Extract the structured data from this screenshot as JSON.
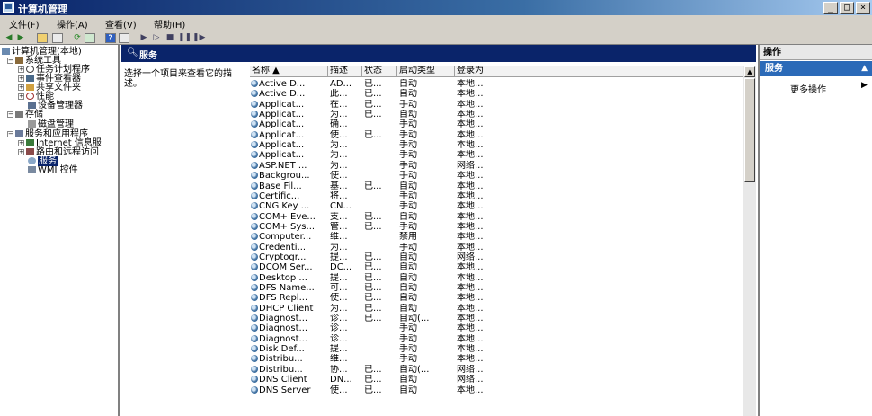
{
  "window": {
    "title": "计算机管理",
    "buttons": [
      "_",
      "□",
      "×"
    ]
  },
  "menu": [
    "文件(F)",
    "操作(A)",
    "查看(V)",
    "帮助(H)"
  ],
  "toolbar": {
    "icons": [
      "back-icon",
      "forward-icon",
      "up-folder-icon",
      "show-hide-tree-icon",
      "refresh-icon",
      "export-icon",
      "help-icon",
      "properties-icon",
      "play-icon",
      "play-alt-icon",
      "stop-icon",
      "pause-icon",
      "restart-icon"
    ]
  },
  "tree": [
    {
      "label": "计算机管理(本地)",
      "level": 0,
      "expander": "",
      "icon": "computer-icon"
    },
    {
      "label": "系统工具",
      "level": 1,
      "expander": "−",
      "icon": "tools-icon"
    },
    {
      "label": "任务计划程序",
      "level": 2,
      "expander": "+",
      "icon": "clock-icon"
    },
    {
      "label": "事件查看器",
      "level": 2,
      "expander": "+",
      "icon": "event-viewer-icon"
    },
    {
      "label": "共享文件夹",
      "level": 2,
      "expander": "+",
      "icon": "shared-folder-icon"
    },
    {
      "label": "性能",
      "level": 2,
      "expander": "+",
      "icon": "performance-icon"
    },
    {
      "label": "设备管理器",
      "level": 2,
      "expander": "",
      "icon": "device-manager-icon"
    },
    {
      "label": "存储",
      "level": 1,
      "expander": "−",
      "icon": "storage-icon"
    },
    {
      "label": "磁盘管理",
      "level": 2,
      "expander": "",
      "icon": "disk-icon"
    },
    {
      "label": "服务和应用程序",
      "level": 1,
      "expander": "−",
      "icon": "services-apps-icon"
    },
    {
      "label": "Internet 信息服",
      "level": 2,
      "expander": "+",
      "icon": "iis-icon"
    },
    {
      "label": "路由和远程访问",
      "level": 2,
      "expander": "+",
      "icon": "routing-icon"
    },
    {
      "label": "服务",
      "level": 2,
      "expander": "",
      "icon": "services-icon",
      "selected": true
    },
    {
      "label": "WMI 控件",
      "level": 2,
      "expander": "",
      "icon": "wmi-icon"
    }
  ],
  "main": {
    "title": "服务",
    "description": "选择一个项目来查看它的描述。",
    "columns": [
      "名称 ▲",
      "描述",
      "状态",
      "启动类型",
      "登录为"
    ],
    "rows": [
      [
        "Active D...",
        "AD...",
        "已...",
        "自动",
        "本地..."
      ],
      [
        "Active D...",
        "此...",
        "已...",
        "自动",
        "本地..."
      ],
      [
        "Applicat...",
        "在...",
        "已...",
        "手动",
        "本地..."
      ],
      [
        "Applicat...",
        "为...",
        "已...",
        "自动",
        "本地..."
      ],
      [
        "Applicat...",
        "确...",
        "",
        "手动",
        "本地..."
      ],
      [
        "Applicat...",
        "使...",
        "已...",
        "手动",
        "本地..."
      ],
      [
        "Applicat...",
        "为...",
        "",
        "手动",
        "本地..."
      ],
      [
        "Applicat...",
        "为...",
        "",
        "手动",
        "本地..."
      ],
      [
        "ASP.NET ...",
        "为...",
        "",
        "手动",
        "网络..."
      ],
      [
        "Backgrou...",
        "使...",
        "",
        "手动",
        "本地..."
      ],
      [
        "Base Fil...",
        "基...",
        "已...",
        "自动",
        "本地..."
      ],
      [
        "Certific...",
        "将...",
        "",
        "手动",
        "本地..."
      ],
      [
        "CNG Key ...",
        "CN...",
        "",
        "手动",
        "本地..."
      ],
      [
        "COM+ Eve...",
        "支...",
        "已...",
        "自动",
        "本地..."
      ],
      [
        "COM+ Sys...",
        "管...",
        "已...",
        "手动",
        "本地..."
      ],
      [
        "Computer...",
        "维...",
        "",
        "禁用",
        "本地..."
      ],
      [
        "Credenti...",
        "为...",
        "",
        "手动",
        "本地..."
      ],
      [
        "Cryptogr...",
        "提...",
        "已...",
        "自动",
        "网络..."
      ],
      [
        "DCOM Ser...",
        "DC...",
        "已...",
        "自动",
        "本地..."
      ],
      [
        "Desktop ...",
        "提...",
        "已...",
        "自动",
        "本地..."
      ],
      [
        "DFS Name...",
        "可...",
        "已...",
        "自动",
        "本地..."
      ],
      [
        "DFS Repl...",
        "使...",
        "已...",
        "自动",
        "本地..."
      ],
      [
        "DHCP Client",
        "为...",
        "已...",
        "自动",
        "本地..."
      ],
      [
        "Diagnost...",
        "诊...",
        "已...",
        "自动(...",
        "本地..."
      ],
      [
        "Diagnost...",
        "诊...",
        "",
        "手动",
        "本地..."
      ],
      [
        "Diagnost...",
        "诊...",
        "",
        "手动",
        "本地..."
      ],
      [
        "Disk Def...",
        "提...",
        "",
        "手动",
        "本地..."
      ],
      [
        "Distribu...",
        "维...",
        "",
        "手动",
        "本地..."
      ],
      [
        "Distribu...",
        "协...",
        "已...",
        "自动(...",
        "网络..."
      ],
      [
        "DNS Client",
        "DN...",
        "已...",
        "自动",
        "网络..."
      ],
      [
        "DNS Server",
        "使...",
        "已...",
        "自动",
        "本地..."
      ]
    ]
  },
  "actions": {
    "title": "操作",
    "section": "服务",
    "item": "更多操作"
  }
}
